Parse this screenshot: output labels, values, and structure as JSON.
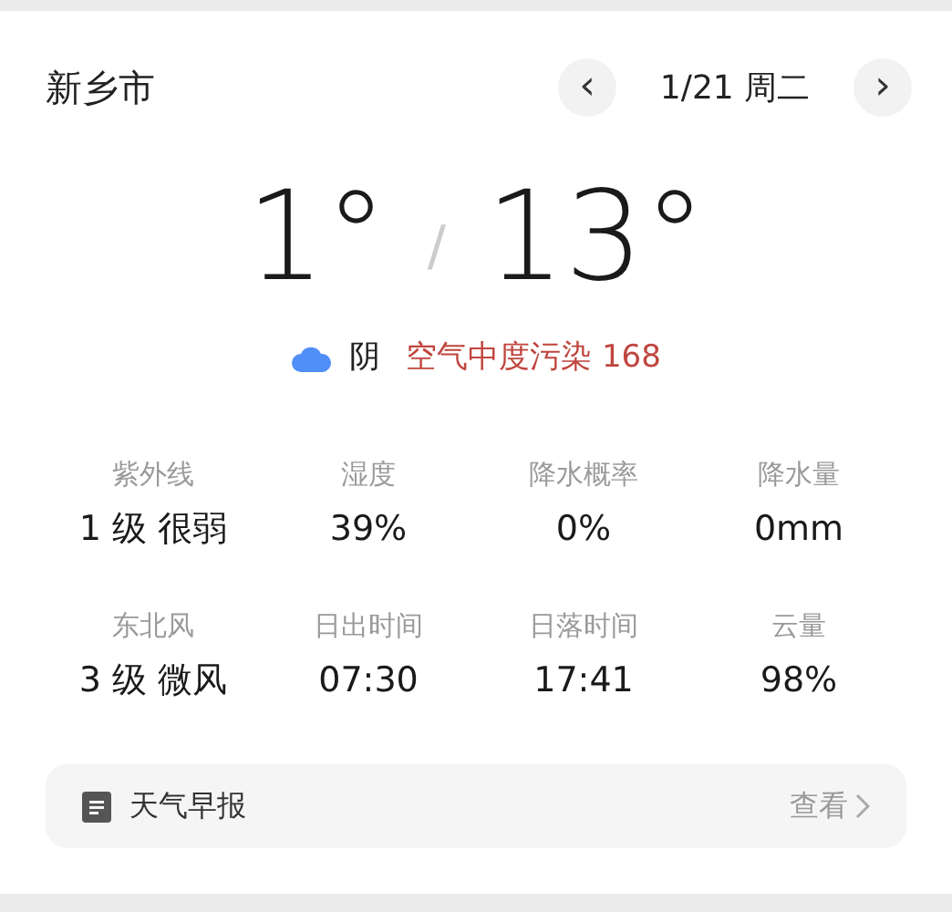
{
  "header": {
    "city": "新乡市",
    "prev": "‹",
    "date": "1/21 周二",
    "next": "›"
  },
  "temperature": {
    "low": "1°",
    "separator": "/",
    "high": "13°"
  },
  "condition": {
    "weather": "阴",
    "air_quality": "空气中度污染 168"
  },
  "stats": [
    {
      "label": "紫外线",
      "value": "1 级 很弱"
    },
    {
      "label": "湿度",
      "value": "39%"
    },
    {
      "label": "降水概率",
      "value": "0%"
    },
    {
      "label": "降水量",
      "value": "0mm"
    },
    {
      "label": "东北风",
      "value": "3 级 微风"
    },
    {
      "label": "日出时间",
      "value": "07:30"
    },
    {
      "label": "日落时间",
      "value": "17:41"
    },
    {
      "label": "云量",
      "value": "98%"
    }
  ],
  "report": {
    "title": "天气早报",
    "action": "查看"
  }
}
